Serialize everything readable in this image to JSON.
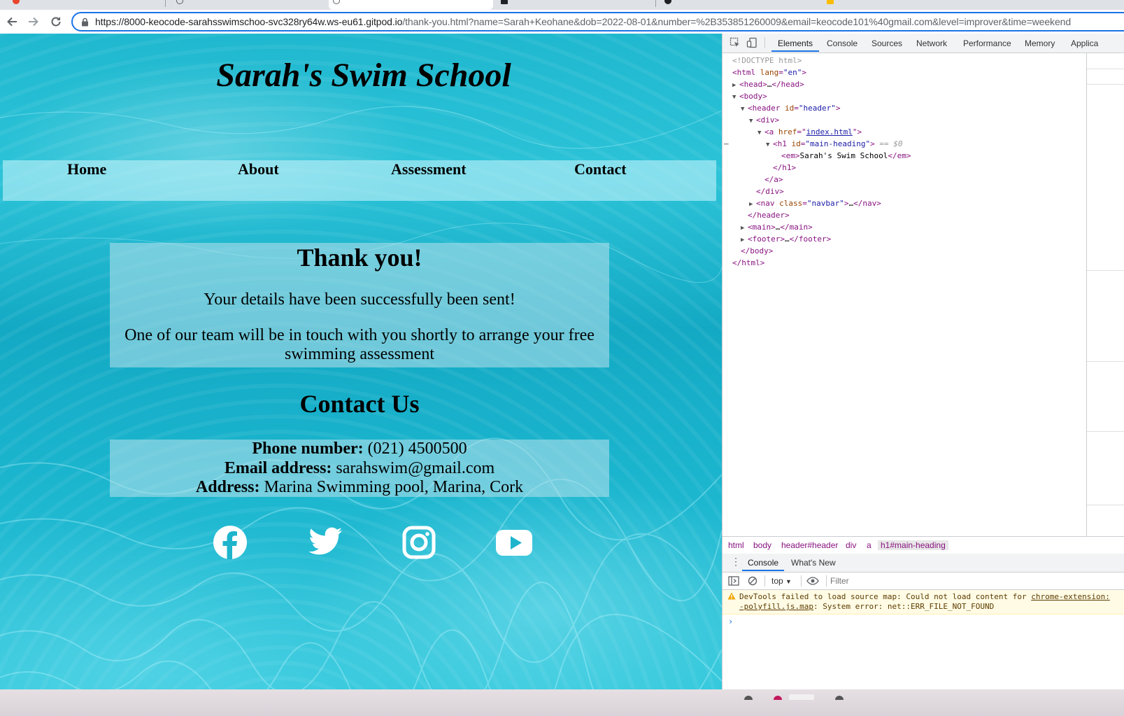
{
  "browser": {
    "url": {
      "host": "https://8000-keocode-sarahsswimschoo-svc328ry64w.ws-eu61.gitpod.io",
      "path": "/thank-you.html?name=Sarah+Keohane&dob=2022-08-01&number=%2B353851260009&email=keocode101%40gmail.com&level=improver&time=weekend"
    }
  },
  "site": {
    "title": "Sarah's Swim School",
    "nav": [
      "Home",
      "About",
      "Assessment",
      "Contact"
    ],
    "thanks": {
      "heading": "Thank you!",
      "line1": "Your details have been successfully been sent!",
      "line2": "One of our team will be in touch with you shortly to arrange your free swimming assessment"
    },
    "contact": {
      "heading": "Contact Us",
      "phone_label": "Phone number:",
      "phone_value": "(021) 4500500",
      "email_label": "Email address:",
      "email_value": "sarahswim@gmail.com",
      "address_label": "Address:",
      "address_value": "Marina Swimming pool, Marina, Cork"
    },
    "social_icons": [
      "facebook-icon",
      "twitter-icon",
      "instagram-icon",
      "youtube-icon"
    ]
  },
  "devtools": {
    "tabs": [
      "Elements",
      "Console",
      "Sources",
      "Network",
      "Performance",
      "Memory",
      "Applica"
    ],
    "active_tab": "Elements",
    "dom": {
      "doctype": "<!DOCTYPE html>",
      "html_open": "html",
      "lang_attr": "lang",
      "lang_val": "\"en\"",
      "head": "head",
      "head_ellipsis": "…",
      "body": "body",
      "header": "header",
      "id_attr": "id",
      "header_id": "\"header\"",
      "div": "div",
      "a": "a",
      "href_attr": "href",
      "href_val": "index.html",
      "h1": "h1",
      "h1_id": "\"main-heading\"",
      "selected_marker": "== $0",
      "em": "em",
      "em_text": "Sarah's Swim School",
      "nav": "nav",
      "class_attr": "class",
      "nav_class": "\"navbar\"",
      "main": "main",
      "footer": "footer"
    },
    "breadcrumb": [
      "html",
      "body",
      "header#header",
      "div",
      "a",
      "h1#main-heading"
    ],
    "drawer_tabs": [
      "Console",
      "What's New"
    ],
    "console_context": "top",
    "filter_placeholder": "Filter",
    "warning_line1": "DevTools failed to load source map: Could not load content for",
    "warning_link1": "chrome-extension:",
    "warning_link2": "-polyfill.js.map",
    "warning_line2": ": System error: net::ERR_FILE_NOT_FOUND"
  }
}
